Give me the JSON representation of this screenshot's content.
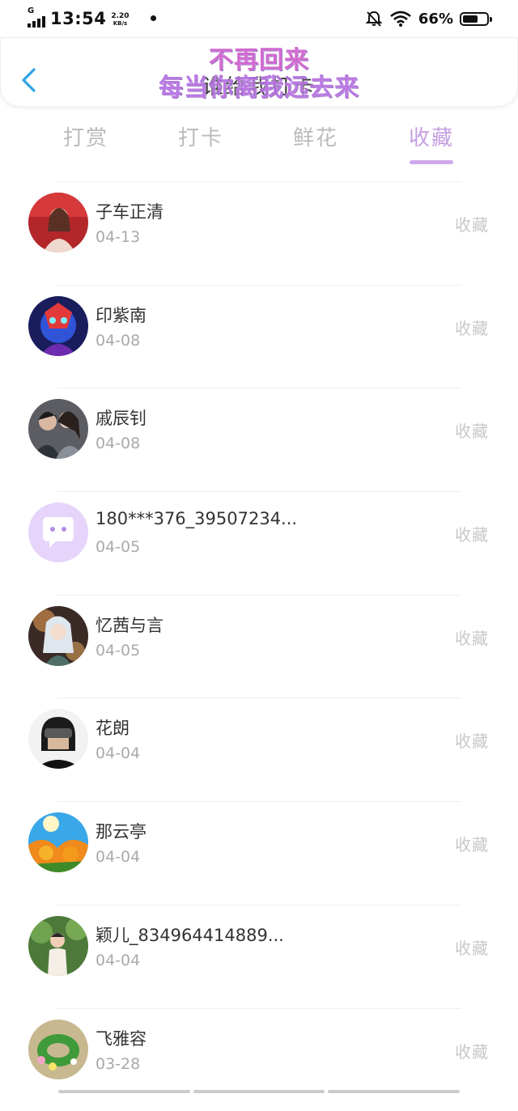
{
  "status_bar": {
    "network": "G",
    "time": "13:54",
    "speed_value": "2.20",
    "speed_unit": "KB/s",
    "battery_text": "66%",
    "battery_level": 0.66
  },
  "header": {
    "title": "谁给我打卡",
    "watermark_line1": "不再回来",
    "watermark_line2": "每当你离我远去来"
  },
  "tabs": [
    {
      "label": "打赏"
    },
    {
      "label": "打卡"
    },
    {
      "label": "鲜花"
    },
    {
      "label": "收藏"
    }
  ],
  "active_tab": 3,
  "rows": [
    {
      "name": "子车正清",
      "date": "04-13",
      "action": "收藏",
      "avatar": "photo-red"
    },
    {
      "name": "印紫南",
      "date": "04-08",
      "action": "收藏",
      "avatar": "photo-blue"
    },
    {
      "name": "戚辰钊",
      "date": "04-08",
      "action": "收藏",
      "avatar": "photo-couple"
    },
    {
      "name": "180***376_39507234...",
      "date": "04-05",
      "action": "收藏",
      "avatar": "default-chat"
    },
    {
      "name": "忆茜与言",
      "date": "04-05",
      "action": "收藏",
      "avatar": "photo-anime"
    },
    {
      "name": "花朗",
      "date": "04-04",
      "action": "收藏",
      "avatar": "photo-helmet"
    },
    {
      "name": "那云亭",
      "date": "04-04",
      "action": "收藏",
      "avatar": "photo-flowers"
    },
    {
      "name": "颖儿_834964414889...",
      "date": "04-04",
      "action": "收藏",
      "avatar": "photo-child"
    },
    {
      "name": "飞雅容",
      "date": "03-28",
      "action": "收藏",
      "avatar": "photo-wreath"
    }
  ],
  "colors": {
    "accent": "#c59ee0",
    "back_arrow": "#2fa4e7",
    "tab_inactive": "#bbbbbb"
  }
}
